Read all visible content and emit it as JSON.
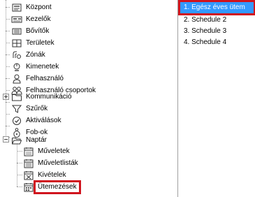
{
  "tree": {
    "items": [
      {
        "label": "Központ",
        "icon": "central-unit-icon"
      },
      {
        "label": "Kezelők",
        "icon": "keypad-icon"
      },
      {
        "label": "Bővítők",
        "icon": "expander-module-icon"
      },
      {
        "label": "Területek",
        "icon": "area-icon"
      },
      {
        "label": "Zónák",
        "icon": "zone-sensor-icon"
      },
      {
        "label": "Kimenetek",
        "icon": "output-icon"
      },
      {
        "label": "Felhasználó",
        "icon": "user-icon"
      },
      {
        "label": "Felhasználó csoportok",
        "icon": "user-group-icon"
      },
      {
        "label": "Kommunikáció",
        "icon": "folder-icon"
      },
      {
        "label": "Szűrők",
        "icon": "filter-icon"
      },
      {
        "label": "Aktiválások",
        "icon": "activation-icon"
      },
      {
        "label": "Fob-ok",
        "icon": "key-fob-icon"
      },
      {
        "label": "Naptár",
        "icon": "open-folder-icon"
      },
      {
        "label": "Műveletek",
        "icon": "calendar-icon"
      },
      {
        "label": "Műveletlisták",
        "icon": "calendar-list-icon"
      },
      {
        "label": "Kivételek",
        "icon": "calendar-exception-icon"
      },
      {
        "label": "Ütemezések",
        "icon": "calendar-schedule-icon"
      }
    ]
  },
  "schedules": {
    "items": [
      {
        "label": "1. Egész éves ütem"
      },
      {
        "label": "2. Schedule 2"
      },
      {
        "label": "3. Schedule 3"
      },
      {
        "label": "4. Schedule 4"
      }
    ],
    "selected_index": 0
  },
  "colors": {
    "highlight_outline": "#d0141e",
    "selection_background": "#3399ff"
  }
}
